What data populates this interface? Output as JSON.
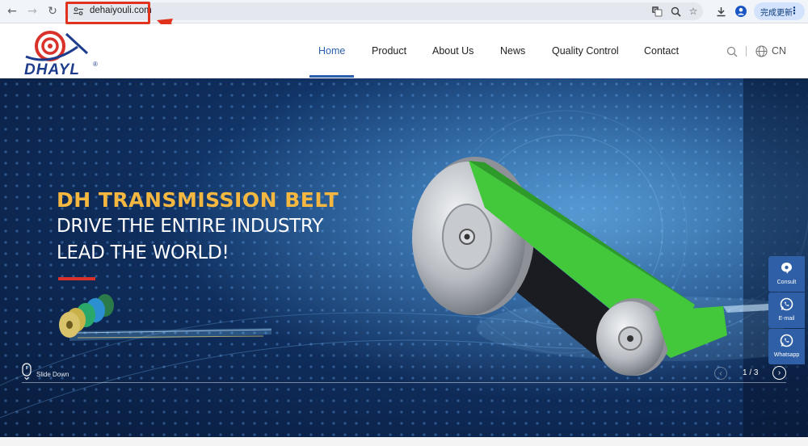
{
  "browser": {
    "url": "dehaiyouli.com",
    "update_label": "完成更新",
    "annotation_color": "#e0321d"
  },
  "header": {
    "logo_text": "DHAYL",
    "logo_reg": "®",
    "nav": [
      {
        "label": "Home",
        "active": true
      },
      {
        "label": "Product"
      },
      {
        "label": "About Us"
      },
      {
        "label": "News"
      },
      {
        "label": "Quality Control"
      },
      {
        "label": "Contact"
      }
    ],
    "language": "CN",
    "accent_color": "#2b5fae"
  },
  "hero": {
    "title": "DH TRANSMISSION BELT",
    "line1": "DRIVE THE ENTIRE INDUSTRY",
    "line2": "LEAD THE WORLD!",
    "slide_down": "Slide Down",
    "pager": "1 / 3",
    "title_color": "#f4b740",
    "bar_color": "#d8322a"
  },
  "float_buttons": [
    {
      "label": "Consult",
      "icon": "chat-bubble-icon"
    },
    {
      "label": "E-mail",
      "icon": "whatsapp-icon"
    },
    {
      "label": "Whatsapp",
      "icon": "whatsapp-icon"
    }
  ]
}
